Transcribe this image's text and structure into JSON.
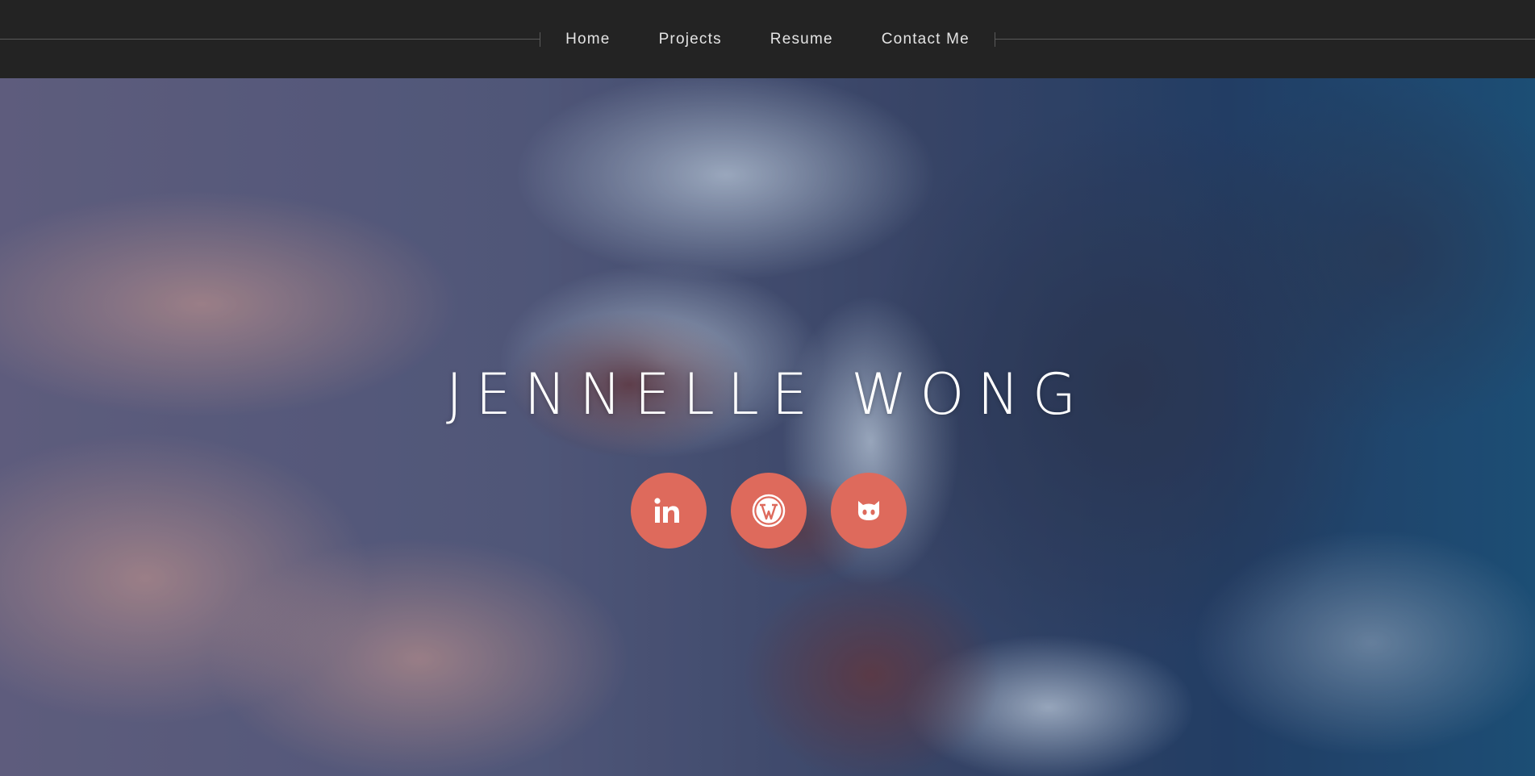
{
  "nav": {
    "items": [
      {
        "label": "Home"
      },
      {
        "label": "Projects"
      },
      {
        "label": "Resume"
      },
      {
        "label": "Contact Me"
      }
    ]
  },
  "hero": {
    "title": "JENNELLE WONG",
    "background": "ocean-rocks-photo",
    "socials": [
      {
        "icon": "linkedin-icon",
        "label": "in"
      },
      {
        "icon": "wordpress-icon"
      },
      {
        "icon": "github-icon"
      }
    ]
  },
  "colors": {
    "navbar": "#232323",
    "nav_text": "#e4e4e4",
    "accent": "#de6a5c",
    "title": "#ffffff"
  }
}
